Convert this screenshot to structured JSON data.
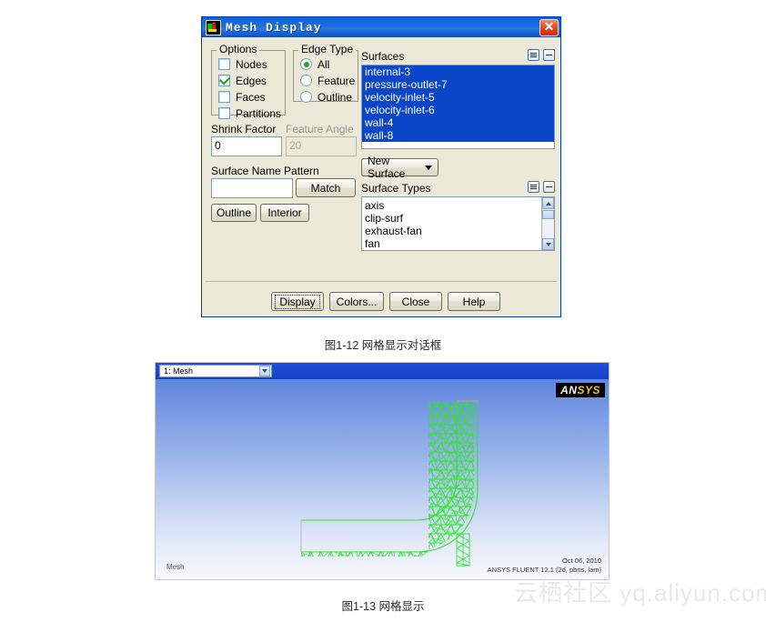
{
  "dialog": {
    "title": "Mesh Display",
    "close_label": "✕",
    "options": {
      "group_label": "Options",
      "items": [
        {
          "label": "Nodes",
          "checked": false
        },
        {
          "label": "Edges",
          "checked": true
        },
        {
          "label": "Faces",
          "checked": false
        },
        {
          "label": "Partitions",
          "checked": false
        }
      ]
    },
    "edge_type": {
      "group_label": "Edge Type",
      "items": [
        {
          "label": "All",
          "selected": true
        },
        {
          "label": "Feature",
          "selected": false
        },
        {
          "label": "Outline",
          "selected": false
        }
      ]
    },
    "shrink_factor": {
      "label": "Shrink Factor",
      "value": "0"
    },
    "feature_angle": {
      "label": "Feature Angle",
      "value": "20",
      "disabled": true
    },
    "surface_name_pattern": {
      "label": "Surface Name Pattern",
      "value": "",
      "match_label": "Match"
    },
    "outline_label": "Outline",
    "interior_label": "Interior",
    "surfaces": {
      "label": "Surfaces",
      "items": [
        {
          "name": "internal-3",
          "selected": true
        },
        {
          "name": "pressure-outlet-7",
          "selected": true
        },
        {
          "name": "velocity-inlet-5",
          "selected": true
        },
        {
          "name": "velocity-inlet-6",
          "selected": true
        },
        {
          "name": "wall-4",
          "selected": true
        },
        {
          "name": "wall-8",
          "selected": true
        }
      ]
    },
    "new_surface": {
      "label": "New Surface"
    },
    "surface_types": {
      "label": "Surface Types",
      "items": [
        {
          "name": "axis"
        },
        {
          "name": "clip-surf"
        },
        {
          "name": "exhaust-fan"
        },
        {
          "name": "fan"
        }
      ]
    },
    "buttons": [
      {
        "label": "Display",
        "focused": true
      },
      {
        "label": "Colors...",
        "focused": false
      },
      {
        "label": "Close",
        "focused": false
      },
      {
        "label": "Help",
        "focused": false
      }
    ]
  },
  "caption_1": "图1-12 网格显示对话框",
  "caption_2": "图1-13 网格显示",
  "fluent": {
    "mesh_selector": "1: Mesh",
    "logo_a": "AN",
    "logo_b": "SYS",
    "mesh_tag": "Mesh",
    "stamp_date": "Oct 06, 2010",
    "stamp_version": "ANSYS FLUENT 12.1 (2d, pbns, lam)",
    "mesh_color": "#2ee62e",
    "bg_top": "#5f86de",
    "bg_bottom": "#f7f8fc"
  },
  "watermark": "云栖社区 yq.aliyun.com"
}
